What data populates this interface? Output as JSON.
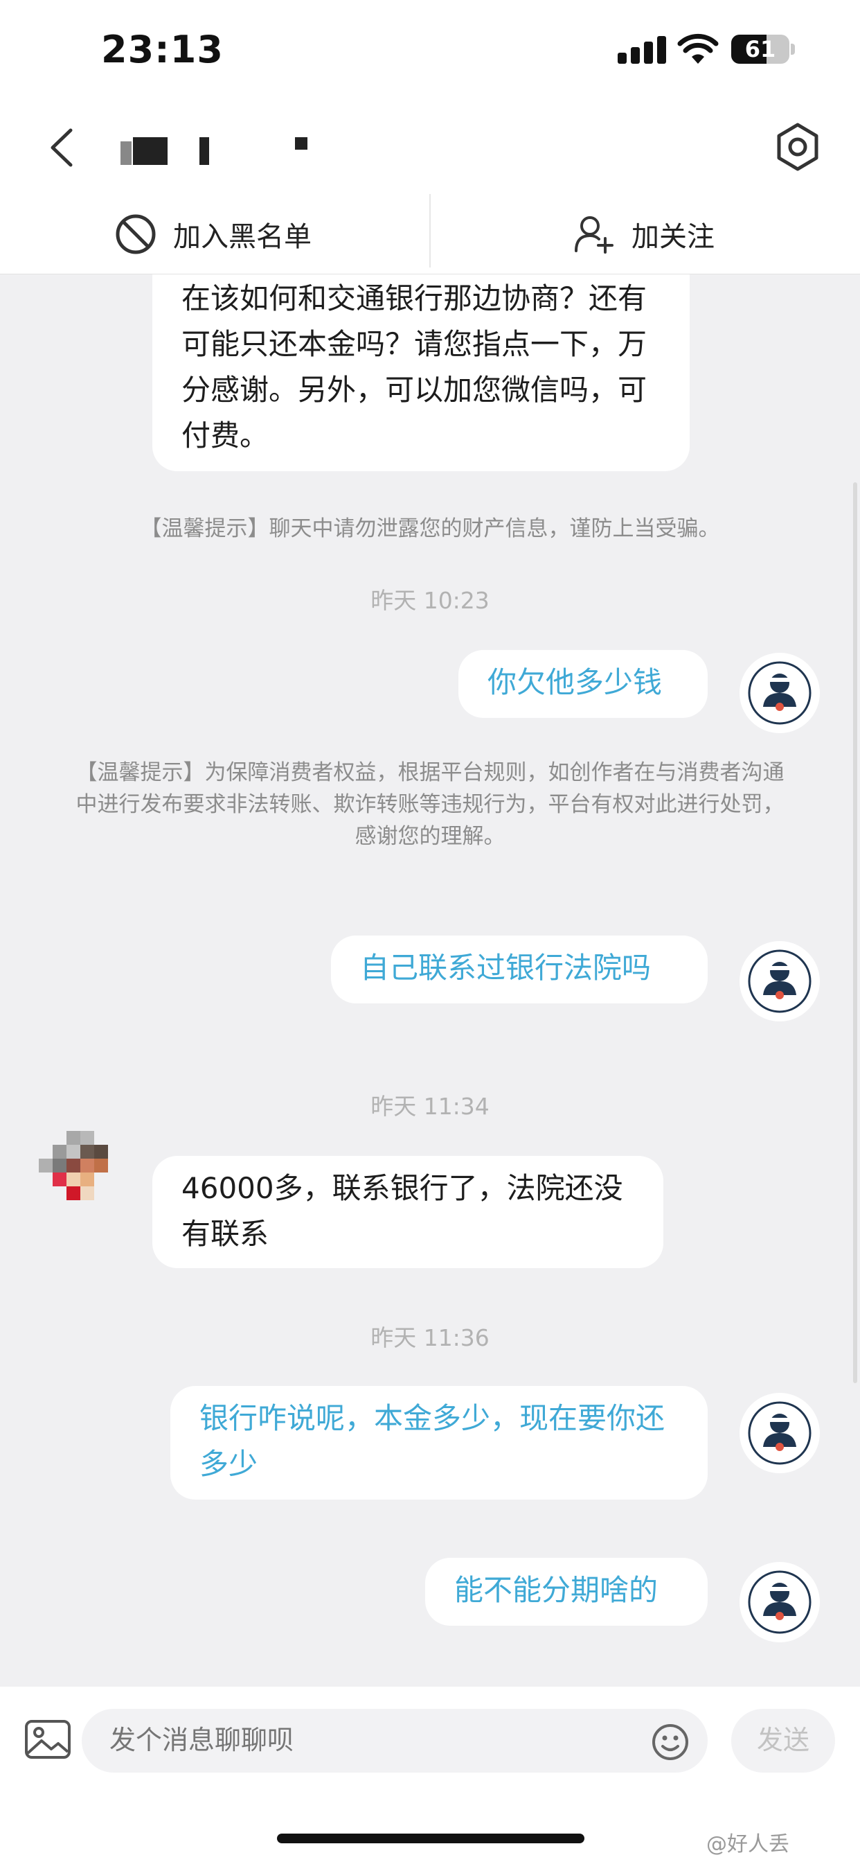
{
  "status_bar": {
    "time": "23:13",
    "battery_level": "61",
    "battery_fraction": 0.61
  },
  "header": {
    "contact_name": "",
    "back_icon": "chevron-left-icon",
    "settings_icon": "gear-icon"
  },
  "actions": {
    "block_label": "加入黑名单",
    "block_icon": "block-icon",
    "follow_label": "加关注",
    "follow_icon": "add-user-icon"
  },
  "messages": [
    {
      "type": "incoming",
      "text": "在该如何和交通银行那边协商？还有可能只还本金吗？请您指点一下，万分感谢。另外，可以加您微信吗，可付费。"
    },
    {
      "type": "notice",
      "text": "【温馨提示】聊天中请勿泄露您的财产信息，谨防上当受骗。"
    },
    {
      "type": "time",
      "text": "昨天 10:23"
    },
    {
      "type": "outgoing",
      "text": "你欠他多少钱"
    },
    {
      "type": "notice",
      "text": "【温馨提示】为保障消费者权益，根据平台规则，如创作者在与消费者沟通中进行发布要求非法转账、欺诈转账等违规行为，平台有权对此进行处罚，感谢您的理解。"
    },
    {
      "type": "outgoing",
      "text": "自己联系过银行法院吗"
    },
    {
      "type": "time",
      "text": "昨天 11:34"
    },
    {
      "type": "incoming",
      "text": "46000多，联系银行了，法院还没有联系"
    },
    {
      "type": "time",
      "text": "昨天 11:36"
    },
    {
      "type": "outgoing",
      "text": "银行咋说呢，本金多少，现在要你还多少"
    },
    {
      "type": "outgoing",
      "text": "能不能分期啥的"
    }
  ],
  "input": {
    "placeholder": "发个消息聊聊呗",
    "send_label": "发送",
    "image_icon": "image-icon",
    "emoji_icon": "emoji-icon"
  },
  "watermark": "@好人丢",
  "colors": {
    "outgoing_text": "#3fa9d6",
    "background": "#f0f0f2",
    "notice_text": "#8c8c8c"
  }
}
